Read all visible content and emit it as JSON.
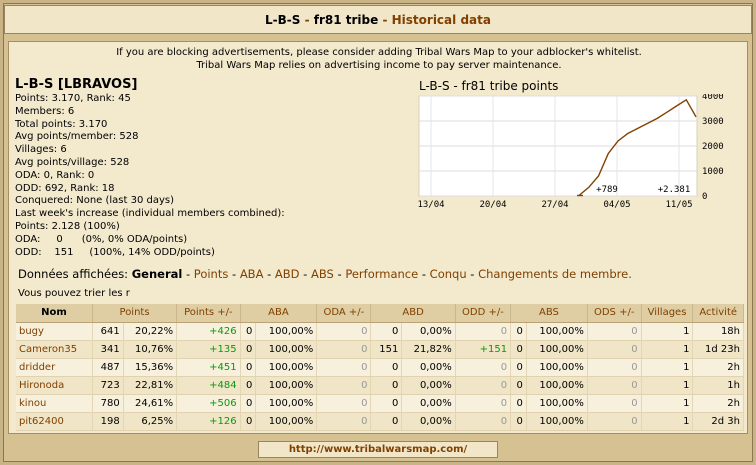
{
  "title": {
    "tribe": "L-B-S",
    "separator": " - ",
    "world": "fr81 tribe",
    "subtitle": "Historical data"
  },
  "notice": {
    "line1": "If you are blocking advertisements, please consider adding Tribal Wars Map to your adblocker's whitelist.",
    "line2": "Tribal Wars Map relies on advertising income to pay server maintenance."
  },
  "info": {
    "name": "L-B-S [LBRAVOS]",
    "rows": [
      "Points: 3.170, Rank: 45",
      "Members: 6",
      "Total points: 3.170",
      "Avg points/member: 528",
      "Villages: 6",
      "Avg points/village: 528",
      "ODA: 0, Rank: 0",
      "ODD: 692, Rank: 18",
      "Conquered: None (last 30 days)",
      "Last week's increase (individual members combined):",
      "Points: 2.128 (100%)",
      "ODA:     0      (0%, 0% ODA/points)",
      "ODD:    151     (100%, 14% ODD/points)"
    ]
  },
  "chart_data": {
    "type": "line",
    "title": "L-B-S - fr81 tribe points",
    "x": [
      "2024-05-01",
      "2024-05-02",
      "2024-05-03",
      "2024-05-04",
      "2024-05-05",
      "2024-05-06",
      "2024-05-07",
      "2024-05-08",
      "2024-05-09",
      "2024-05-10",
      "2024-05-11",
      "2024-05-12",
      "2024-05-13"
    ],
    "series": [
      {
        "values": [
          20,
          350,
          800,
          1700,
          2200,
          2500,
          2700,
          2900,
          3100,
          3350,
          3600,
          3850,
          3170
        ]
      }
    ],
    "xticks": [
      "13/04",
      "20/04",
      "27/04",
      "04/05",
      "11/05"
    ],
    "yticks": [
      "0",
      "1000",
      "2000",
      "3000",
      "4000"
    ],
    "ylim": [
      0,
      4000
    ],
    "annotations": [
      "+789",
      "+2.381"
    ],
    "grid": true
  },
  "tabs": {
    "prefix": "Données affichées:",
    "items": [
      "General",
      "Points",
      "ABA",
      "ABD",
      "ABS",
      "Performance",
      "Conqu",
      "Changements de membre."
    ],
    "dash": " - "
  },
  "sort_hint": "Vous pouvez trier les r",
  "table": {
    "headers": [
      "Nom",
      "Points",
      "Points +/-",
      "ABA",
      "ODA +/-",
      "ABD",
      "ODD +/-",
      "ABS",
      "ODS +/-",
      "Villages",
      "Activité"
    ],
    "rows": [
      [
        "bugy",
        "641",
        "20,22%",
        "+426",
        "0",
        "100,00%",
        "0",
        "0",
        "0,00%",
        "0",
        "0",
        "100,00%",
        "0",
        "1",
        "18h"
      ],
      [
        "Cameron35",
        "341",
        "10,76%",
        "+135",
        "0",
        "100,00%",
        "0",
        "151",
        "21,82%",
        "+151",
        "0",
        "100,00%",
        "0",
        "1",
        "1d 23h"
      ],
      [
        "dridder",
        "487",
        "15,36%",
        "+451",
        "0",
        "100,00%",
        "0",
        "0",
        "0,00%",
        "0",
        "0",
        "100,00%",
        "0",
        "1",
        "2h"
      ],
      [
        "Hironoda",
        "723",
        "22,81%",
        "+484",
        "0",
        "100,00%",
        "0",
        "0",
        "0,00%",
        "0",
        "0",
        "100,00%",
        "0",
        "1",
        "1h"
      ],
      [
        "kinou",
        "780",
        "24,61%",
        "+506",
        "0",
        "100,00%",
        "0",
        "0",
        "0,00%",
        "0",
        "0",
        "100,00%",
        "0",
        "1",
        "2h"
      ],
      [
        "pit62400",
        "198",
        "6,25%",
        "+126",
        "0",
        "100,00%",
        "0",
        "0",
        "0,00%",
        "0",
        "0",
        "100,00%",
        "0",
        "1",
        "2d 3h"
      ]
    ]
  },
  "footer": "http://www.tribalwarsmap.com/"
}
